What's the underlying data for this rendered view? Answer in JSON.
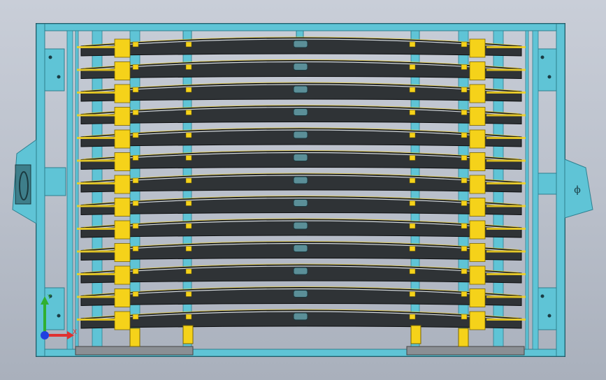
{
  "viewport": {
    "background": [
      "#c9ced8",
      "#a9b0bc"
    ]
  },
  "model": {
    "frame_color": "#5fc4d6",
    "frame_dark": "#2e7f8f",
    "clamp_color": "#f5d21a",
    "leaf_color": "#2f3336",
    "leaf_edge": "#0e0f10",
    "leaf_count": 13,
    "right_handle_symbol": "ϕ"
  },
  "triad": {
    "x_axis_label": "X",
    "y_axis_label": "Y",
    "x_color": "#e03030",
    "y_color": "#30b030",
    "z_color": "#2040e0"
  }
}
